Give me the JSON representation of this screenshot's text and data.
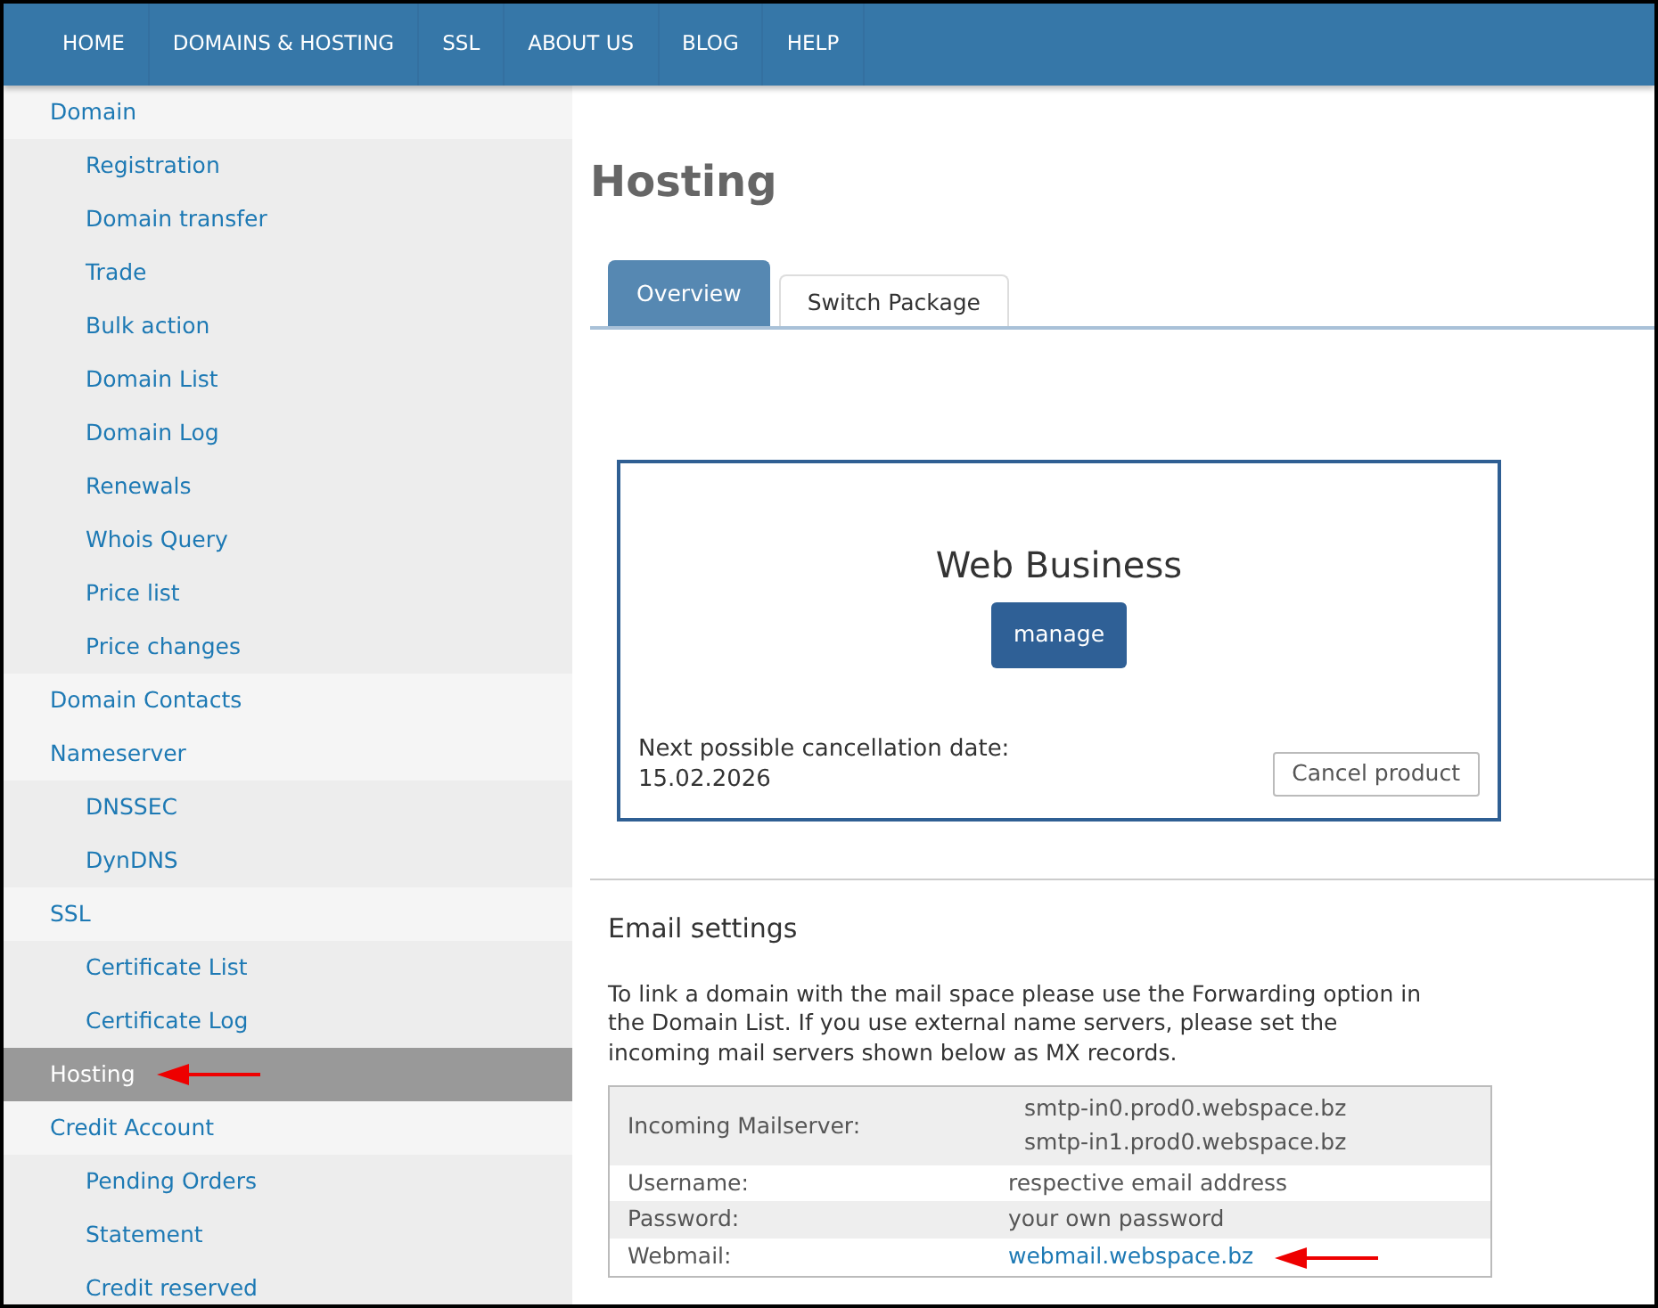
{
  "nav": [
    {
      "label": "HOME"
    },
    {
      "label": "DOMAINS & HOSTING"
    },
    {
      "label": "SSL"
    },
    {
      "label": "ABOUT US"
    },
    {
      "label": "BLOG"
    },
    {
      "label": "HELP"
    }
  ],
  "sidebar": [
    {
      "label": "Domain",
      "selected": false,
      "children": [
        {
          "label": "Registration",
          "selected": false
        },
        {
          "label": "Domain transfer",
          "selected": false
        },
        {
          "label": "Trade",
          "selected": false
        },
        {
          "label": "Bulk action",
          "selected": false
        },
        {
          "label": "Domain List",
          "selected": false
        },
        {
          "label": "Domain Log",
          "selected": false
        },
        {
          "label": "Renewals",
          "selected": false
        },
        {
          "label": "Whois Query",
          "selected": false
        },
        {
          "label": "Price list",
          "selected": false
        },
        {
          "label": "Price changes",
          "selected": false
        }
      ]
    },
    {
      "label": "Domain Contacts",
      "selected": false
    },
    {
      "label": "Nameserver",
      "selected": false,
      "children": [
        {
          "label": "DNSSEC",
          "selected": false
        },
        {
          "label": "DynDNS",
          "selected": false
        }
      ]
    },
    {
      "label": "SSL",
      "selected": false,
      "children": [
        {
          "label": "Certificate List",
          "selected": false
        },
        {
          "label": "Certificate Log",
          "selected": false
        }
      ]
    },
    {
      "label": "Hosting",
      "selected": true
    },
    {
      "label": "Credit Account",
      "selected": false,
      "children": [
        {
          "label": "Pending Orders",
          "selected": false
        },
        {
          "label": "Statement",
          "selected": false
        },
        {
          "label": "Credit reserved",
          "selected": false
        }
      ]
    }
  ],
  "page_title": "Hosting",
  "tabs": [
    {
      "label": "Overview",
      "selected": true
    },
    {
      "label": "Switch Package",
      "selected": false
    }
  ],
  "product": {
    "name": "Web Business",
    "manage_button": "manage",
    "cancellation_label": "Next possible cancellation date:",
    "cancellation_date": "15.02.2026",
    "cancel_button": "Cancel product"
  },
  "email_settings": {
    "heading": "Email settings",
    "description": "To link a domain with the mail space please use the Forwarding option in the Domain List. If you use external name servers, please set the incoming mail servers shown below as MX records.",
    "rows": [
      {
        "label": "Incoming Mailserver:",
        "kind": "text",
        "values": [
          "smtp-in0.prod0.webspace.bz",
          "smtp-in1.prod0.webspace.bz"
        ]
      },
      {
        "label": "Username:",
        "kind": "text",
        "values": [
          "respective email address"
        ]
      },
      {
        "label": "Password:",
        "kind": "text",
        "values": [
          "your own password"
        ]
      },
      {
        "label": "Webmail:",
        "kind": "link",
        "values": [
          "webmail.webspace.bz"
        ]
      }
    ]
  }
}
